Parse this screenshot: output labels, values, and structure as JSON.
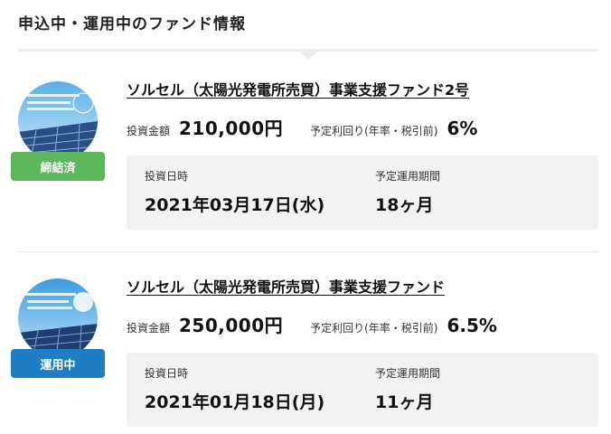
{
  "section": {
    "title": "申込中・運用中のファンド情報"
  },
  "funds": [
    {
      "status": "締結済",
      "status_color": "#5cb85c",
      "name": "ソルセル（太陽光発電所売買）事業支援ファンド2号",
      "amount_label": "投資金額",
      "amount": "210,000円",
      "yield_label": "予定利回り(年率・税引前)",
      "yield": "6%",
      "date_label": "投資日時",
      "date": "2021年03月17日(水)",
      "period_label": "予定運用期間",
      "period": "18ヶ月"
    },
    {
      "status": "運用中",
      "status_color": "#1e7dc3",
      "name": "ソルセル（太陽光発電所売買）事業支援ファンド",
      "amount_label": "投資金額",
      "amount": "250,000円",
      "yield_label": "予定利回り(年率・税引前)",
      "yield": "6.5%",
      "date_label": "投資日時",
      "date": "2021年01月18日(月)",
      "period_label": "予定運用期間",
      "period": "11ヶ月"
    }
  ]
}
